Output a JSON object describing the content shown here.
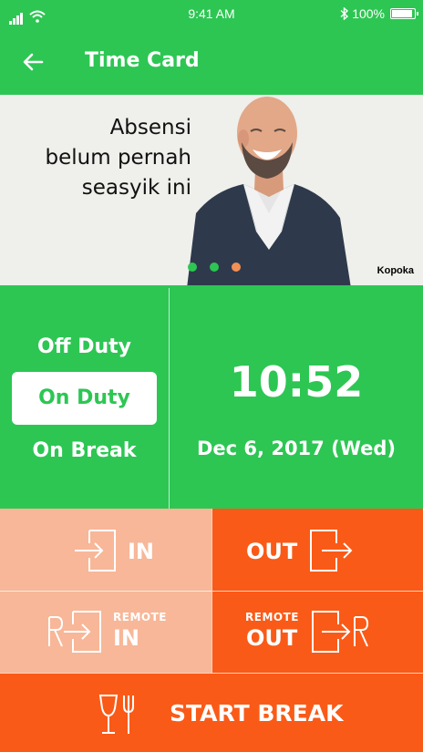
{
  "status_bar": {
    "time": "9:41 AM",
    "battery": "100%",
    "icons": [
      "signal-icon",
      "wifi-icon",
      "bluetooth-icon",
      "battery-icon"
    ]
  },
  "header": {
    "title": "Time Card",
    "back_icon": "arrow-left-icon"
  },
  "banner": {
    "headline_line1": "Absensi",
    "headline_line2": "belum pernah",
    "headline_line3": "seasyik ini",
    "brand": "Kopoka",
    "carousel": {
      "total": 3,
      "active_index": 2
    }
  },
  "duty_status": {
    "options": [
      "Off Duty",
      "On Duty",
      "On Break"
    ],
    "selected": "On Duty"
  },
  "clock": {
    "time": "10:52",
    "date": "Dec 6, 2017 (Wed)"
  },
  "actions": {
    "in_label": "IN",
    "out_label": "OUT",
    "remote_in_small": "REMOTE",
    "remote_in_label": "IN",
    "remote_out_small": "REMOTE",
    "remote_out_label": "OUT",
    "start_break_label": "START BREAK",
    "in_icon": "login-icon",
    "out_icon": "logout-icon",
    "remote_in_icon": "remote-login-icon",
    "remote_out_icon": "remote-logout-icon",
    "break_icon": "glass-fork-icon"
  },
  "colors": {
    "primary_green": "#2DC653",
    "orange": "#FA5A17",
    "light_orange": "#F7B798",
    "active_dot": "#F39055"
  }
}
